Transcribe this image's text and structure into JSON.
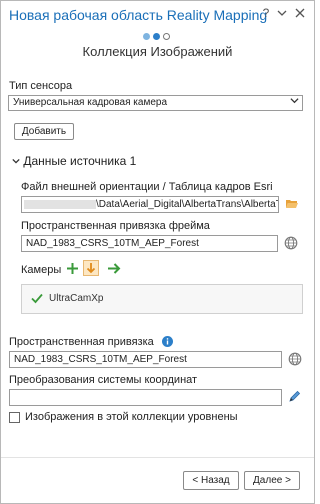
{
  "window": {
    "title": "Новая рабочая область Reality Mapping",
    "help_label": "?",
    "dropdown_icon": "chevron-down-icon",
    "close_icon": "close-icon"
  },
  "wizard": {
    "step_title": "Коллекция Изображений",
    "steps_total": 3,
    "current_step": 2
  },
  "sensor": {
    "label": "Тип сенсора",
    "value": "Универсальная кадровая камера",
    "add_button": "Добавить"
  },
  "source": {
    "section_title": "Данные источника 1",
    "orientation_label": "Файл внешней ориентации / Таблица кадров Esri",
    "orientation_value": "\\Data\\Aerial_Digital\\AlbertaTrans\\AlbertaTra",
    "frame_sr_label": "Пространственная привязка фрейма",
    "frame_sr_value": "NAD_1983_CSRS_10TM_AEP_Forest",
    "cameras_label": "Камеры",
    "cameras": [
      "UltraCamXp"
    ]
  },
  "spatial_ref": {
    "label": "Пространственная привязка",
    "value": "NAD_1983_CSRS_10TM_AEP_Forest"
  },
  "transform": {
    "label": "Преобразования системы координат",
    "value": ""
  },
  "leveled": {
    "label": "Изображения в этой коллекции уровнены",
    "checked": false
  },
  "nav": {
    "back": "< Назад",
    "next": "Далее >"
  },
  "colors": {
    "title_blue": "#1a6fb8",
    "accent_green": "#3a9a3a",
    "accent_orange": "#e8a23a"
  }
}
